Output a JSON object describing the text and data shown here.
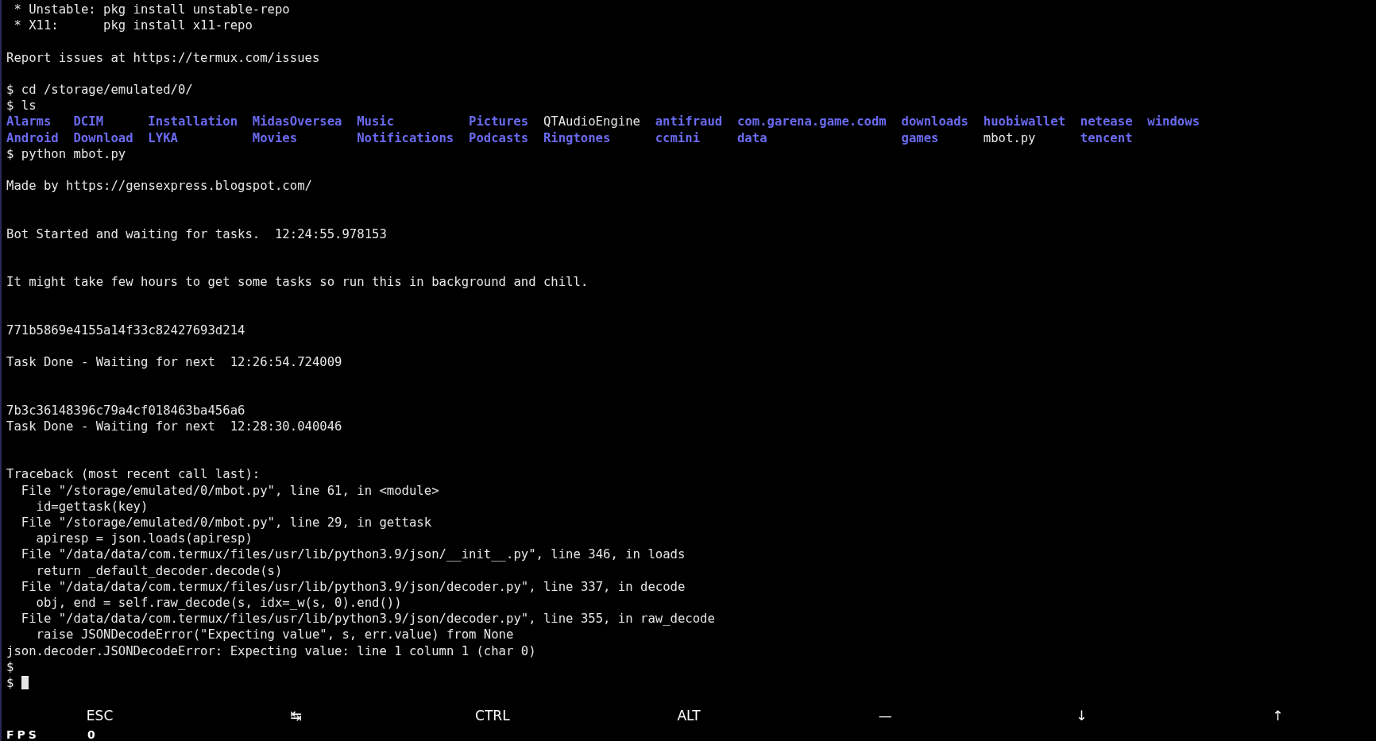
{
  "terminal": {
    "lines": [
      {
        "kind": "text",
        "text": " * Unstable: pkg install unstable-repo"
      },
      {
        "kind": "text",
        "text": " * X11:      pkg install x11-repo"
      },
      {
        "kind": "blank"
      },
      {
        "kind": "text",
        "text": "Report issues at https://termux.com/issues"
      },
      {
        "kind": "blank"
      },
      {
        "kind": "text",
        "text": "$ cd /storage/emulated/0/"
      },
      {
        "kind": "text",
        "text": "$ ls"
      },
      {
        "kind": "listing",
        "columns": [
          [
            {
              "name": "Alarms",
              "kind": "directory"
            },
            {
              "name": "Android",
              "kind": "directory"
            }
          ],
          [
            {
              "name": "DCIM",
              "kind": "directory"
            },
            {
              "name": "Download",
              "kind": "directory"
            }
          ],
          [
            {
              "name": "Installation",
              "kind": "directory"
            },
            {
              "name": "LYKA",
              "kind": "directory"
            }
          ],
          [
            {
              "name": "MidasOversea",
              "kind": "directory"
            },
            {
              "name": "Movies",
              "kind": "directory"
            }
          ],
          [
            {
              "name": "Music",
              "kind": "directory"
            },
            {
              "name": "Notifications",
              "kind": "directory"
            }
          ],
          [
            {
              "name": "Pictures",
              "kind": "directory"
            },
            {
              "name": "Podcasts",
              "kind": "directory"
            }
          ],
          [
            {
              "name": "QTAudioEngine",
              "kind": "file"
            },
            {
              "name": "Ringtones",
              "kind": "directory"
            }
          ],
          [
            {
              "name": "antifraud",
              "kind": "directory"
            },
            {
              "name": "ccmini",
              "kind": "directory"
            }
          ],
          [
            {
              "name": "com.garena.game.codm",
              "kind": "directory"
            },
            {
              "name": "data",
              "kind": "directory"
            }
          ],
          [
            {
              "name": "downloads",
              "kind": "directory"
            },
            {
              "name": "games",
              "kind": "directory"
            }
          ],
          [
            {
              "name": "huobiwallet",
              "kind": "directory"
            },
            {
              "name": "mbot.py",
              "kind": "file"
            }
          ],
          [
            {
              "name": "netease",
              "kind": "directory"
            },
            {
              "name": "tencent",
              "kind": "directory"
            }
          ],
          [
            {
              "name": "windows",
              "kind": "directory"
            }
          ]
        ]
      },
      {
        "kind": "text",
        "text": "$ python mbot.py"
      },
      {
        "kind": "blank"
      },
      {
        "kind": "text",
        "text": "Made by https://gensexpress.blogspot.com/"
      },
      {
        "kind": "blank"
      },
      {
        "kind": "blank"
      },
      {
        "kind": "text",
        "text": "Bot Started and waiting for tasks.  12:24:55.978153"
      },
      {
        "kind": "blank"
      },
      {
        "kind": "blank"
      },
      {
        "kind": "text",
        "text": "It might take few hours to get some tasks so run this in background and chill."
      },
      {
        "kind": "blank"
      },
      {
        "kind": "blank"
      },
      {
        "kind": "text",
        "text": "771b5869e4155a14f33c82427693d214"
      },
      {
        "kind": "blank"
      },
      {
        "kind": "text",
        "text": "Task Done - Waiting for next  12:26:54.724009"
      },
      {
        "kind": "blank"
      },
      {
        "kind": "blank"
      },
      {
        "kind": "text",
        "text": "7b3c36148396c79a4cf018463ba456a6"
      },
      {
        "kind": "text",
        "text": "Task Done - Waiting for next  12:28:30.040046"
      },
      {
        "kind": "blank"
      },
      {
        "kind": "blank"
      },
      {
        "kind": "text",
        "text": "Traceback (most recent call last):"
      },
      {
        "kind": "text",
        "text": "  File \"/storage/emulated/0/mbot.py\", line 61, in <module>"
      },
      {
        "kind": "text",
        "text": "    id=gettask(key)"
      },
      {
        "kind": "text",
        "text": "  File \"/storage/emulated/0/mbot.py\", line 29, in gettask"
      },
      {
        "kind": "text",
        "text": "    apiresp = json.loads(apiresp)"
      },
      {
        "kind": "text",
        "text": "  File \"/data/data/com.termux/files/usr/lib/python3.9/json/__init__.py\", line 346, in loads"
      },
      {
        "kind": "text",
        "text": "    return _default_decoder.decode(s)"
      },
      {
        "kind": "text",
        "text": "  File \"/data/data/com.termux/files/usr/lib/python3.9/json/decoder.py\", line 337, in decode"
      },
      {
        "kind": "text",
        "text": "    obj, end = self.raw_decode(s, idx=_w(s, 0).end())"
      },
      {
        "kind": "text",
        "text": "  File \"/data/data/com.termux/files/usr/lib/python3.9/json/decoder.py\", line 355, in raw_decode"
      },
      {
        "kind": "text",
        "text": "    raise JSONDecodeError(\"Expecting value\", s, err.value) from None"
      },
      {
        "kind": "text",
        "text": "json.decoder.JSONDecodeError: Expecting value: line 1 column 1 (char 0)"
      },
      {
        "kind": "text",
        "text": "$"
      },
      {
        "kind": "cursor",
        "text": "$"
      }
    ]
  },
  "extra_keys": [
    {
      "label": "ESC"
    },
    {
      "label": "↹"
    },
    {
      "label": "CTRL"
    },
    {
      "label": "ALT"
    },
    {
      "label": "—"
    },
    {
      "label": "↓"
    },
    {
      "label": "↑"
    }
  ],
  "fps_overlay": {
    "label": "FPS",
    "value": "0"
  }
}
